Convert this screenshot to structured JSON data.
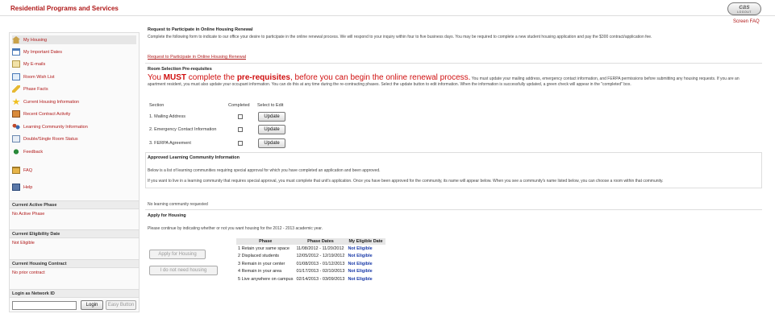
{
  "app": {
    "title": "Residential Programs and Services",
    "cas": "cas",
    "cas_sub": "LOGOUT",
    "screen_faq": "Screen FAQ"
  },
  "sidebar": {
    "items": [
      {
        "label": "My Housing",
        "icon": "house-icon"
      },
      {
        "label": "My Important Dates",
        "icon": "calendar-icon"
      },
      {
        "label": "My E-mails",
        "icon": "mail-icon"
      },
      {
        "label": "Room Wish List",
        "icon": "checklist-icon"
      },
      {
        "label": "Phase Facts",
        "icon": "pencil-icon"
      },
      {
        "label": "Current Housing Information",
        "icon": "star-icon"
      },
      {
        "label": "Recent Contract Activity",
        "icon": "contract-icon"
      },
      {
        "label": "Learning Community Information",
        "icon": "people-icon"
      },
      {
        "label": "Double/Single Room Status",
        "icon": "document-icon"
      },
      {
        "label": "Feedback",
        "icon": "feedback-icon"
      },
      {
        "label": "FAQ",
        "icon": "folder-icon"
      },
      {
        "label": "Help",
        "icon": "book-icon"
      }
    ],
    "active_phase": {
      "title": "Current Active Phase",
      "value": "No Active Phase"
    },
    "eligibility_date": {
      "title": "Current Eligibility Date",
      "value": "Not Eligible"
    },
    "housing_contract": {
      "title": "Current Housing Contract",
      "value": "No prior contract"
    },
    "network_login": {
      "title": "Login as Network ID",
      "input_value": "",
      "login_label": "Login",
      "easy_label": "Easy Button"
    }
  },
  "main": {
    "renewal": {
      "title": "Request to Participate in Online Housing Renewal",
      "text": "Complete the following form to indicate to our office your desire to participate in the online renewal process.  We will respond to your inquiry within four to five business days.  You may be required to complete a new student housing application and pay the $300 contract/application fee.",
      "link": "Request to Participate in Online Housing Renewal"
    },
    "prereqs": {
      "title": "Room Selection Pre-requisites",
      "must_prefix": "You ",
      "must_word": "MUST",
      "must_middle": " complete the ",
      "must_bold": "pre-requisites",
      "must_suffix": ", before you can begin the online renewal process.",
      "instructions": "You must update your mailing address, emergency contact information, and FERPA permissions before submitting any housing requests.  If you are an apartment resident, you must also update your occupant information.  You can do this at any time during the re-contracting phases.  Select the update button to edit information.  When the information is successfully updated, a green check will appear in the \"completed\" box.",
      "col_section": "Section",
      "col_completed": "Completed",
      "col_select": "Select to Edit",
      "rows": [
        {
          "section": "1. Mailing Address",
          "button": "Update"
        },
        {
          "section": "2. Emergency Contact Information",
          "button": "Update"
        },
        {
          "section": "3. FERPA Agreement",
          "button": "Update"
        }
      ]
    },
    "learning": {
      "title": "Approved Learning Community Information",
      "text1": "Below is a list of learning communities requiring special approval for which you have completed an application and been approved.",
      "text2": "If you want to live in a learning community that requires special approval, you must complete that unit's application.  Once you have been approved for the community, its name will appear below.  When you see a community's name listed below, you can choose a room within that community.",
      "none": "No learning community requested"
    },
    "apply": {
      "title": "Apply for Housing",
      "text": "Please continue by indicating whether or not you want housing for the 2012 - 2013 academic year.",
      "apply_btn": "Apply for Housing",
      "no_btn": "I do not need housing",
      "headers": [
        "Phase",
        "Phase Dates",
        "My Eligible Date"
      ],
      "phases": [
        {
          "phase": "1 Retain your same space",
          "dates": "11/08/2012 - 11/20/2012",
          "eligible": "Not Eligible"
        },
        {
          "phase": "2 Displaced students",
          "dates": "12/05/2012 - 12/19/2012",
          "eligible": "Not Eligible"
        },
        {
          "phase": "3 Remain in your center",
          "dates": "01/08/2013 - 01/12/2013",
          "eligible": "Not Eligible"
        },
        {
          "phase": "4 Remain in your area",
          "dates": "01/17/2013 - 02/10/2013",
          "eligible": "Not Eligible"
        },
        {
          "phase": "5 Live anywhere on campus",
          "dates": "02/14/2013 - 03/09/2013",
          "eligible": "Not Eligible"
        }
      ]
    }
  }
}
